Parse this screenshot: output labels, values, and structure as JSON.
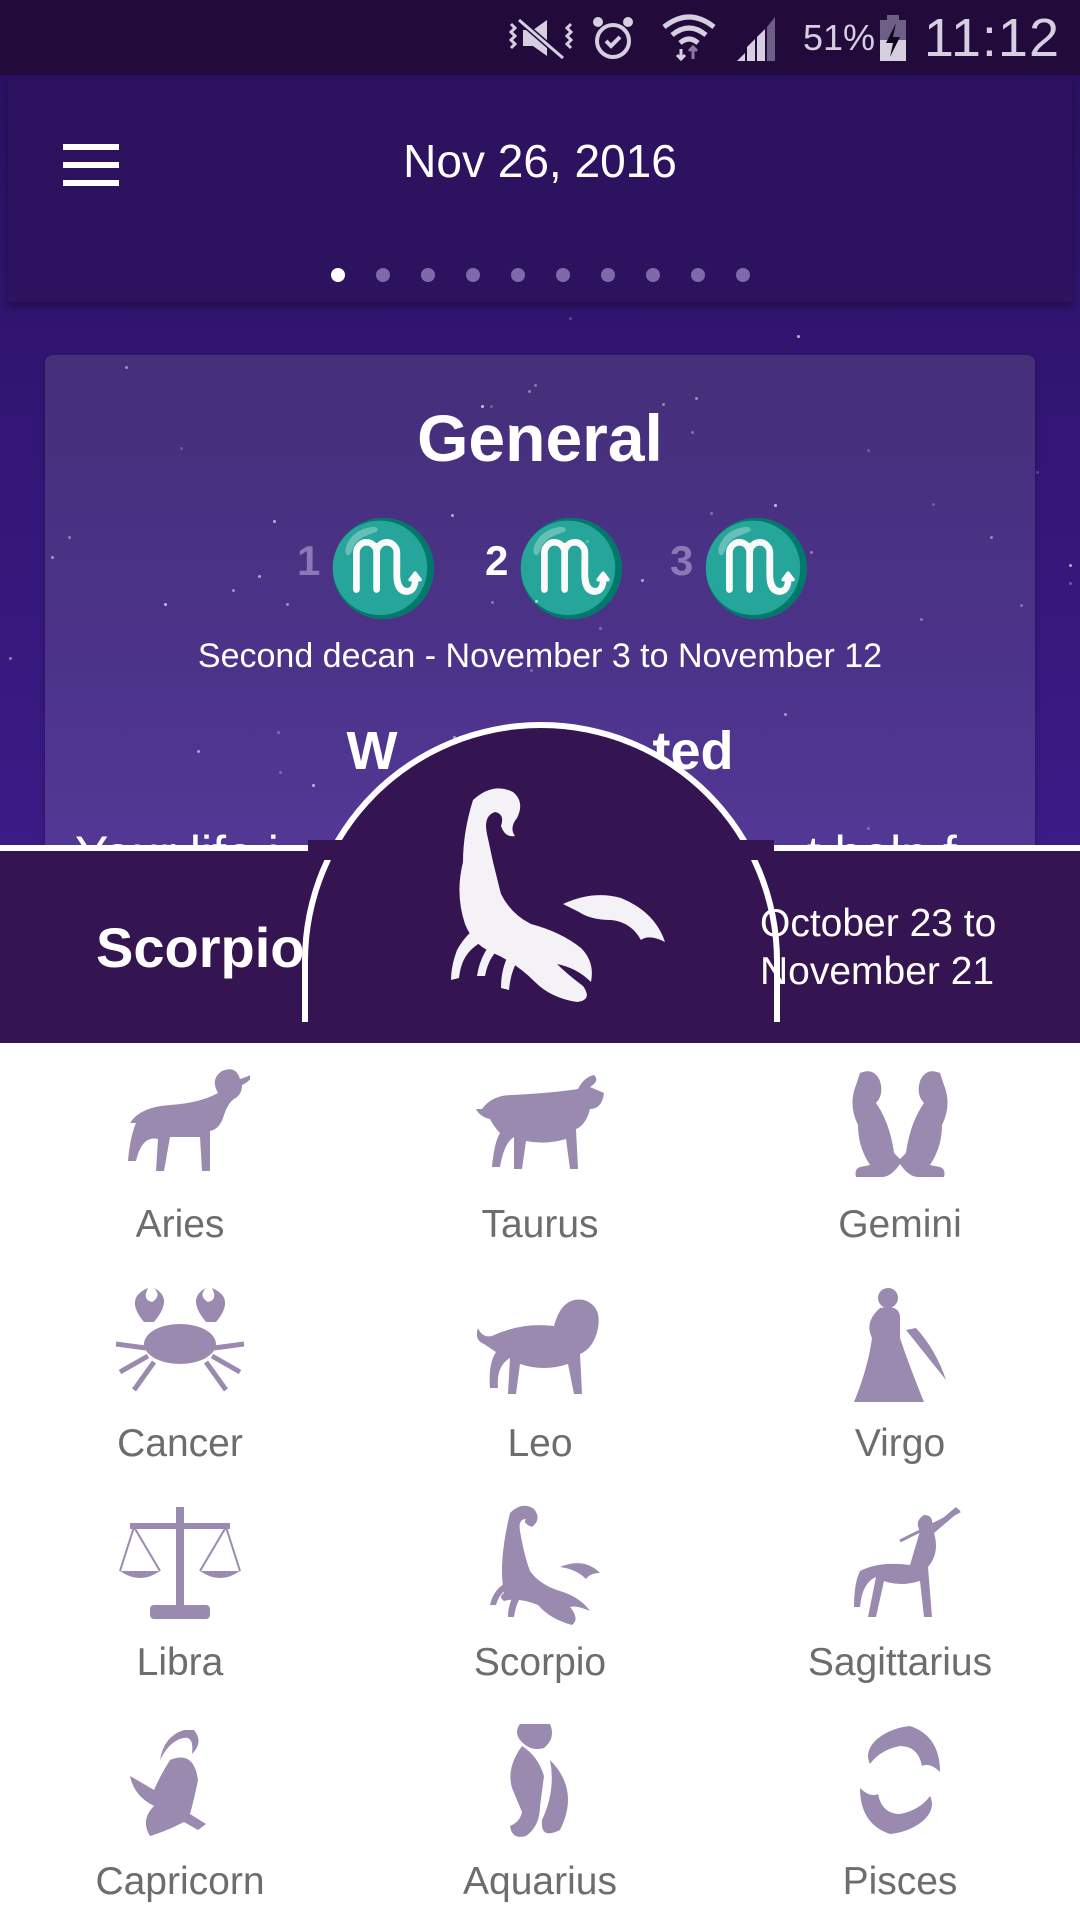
{
  "status_bar": {
    "icons": [
      "mute-vibrate-icon",
      "alarm-icon",
      "wifi-icon",
      "signal-icon",
      "battery-charging-icon"
    ],
    "battery_percent": "51%",
    "time": "11:12"
  },
  "app_bar": {
    "menu_icon": "hamburger-menu-icon",
    "title": "Nov 26, 2016",
    "page_count": 10,
    "active_page": 1
  },
  "card": {
    "title": "General",
    "decans": [
      {
        "number": "1",
        "symbol": "♏",
        "active": false
      },
      {
        "number": "2",
        "symbol": "♏",
        "active": true
      },
      {
        "number": "3",
        "symbol": "♏",
        "active": false
      }
    ],
    "decan_range": "Second decan - November 3 to November 12",
    "subtitle_visible": "W                 ted",
    "body_visible": "Your life i                                      t help f"
  },
  "current_sign": {
    "name": "Scorpio",
    "dates": "October 23 to November 21",
    "dates_line1": "October 23 to",
    "dates_line2": "November 21",
    "icon": "scorpion-icon"
  },
  "colors": {
    "status_bar": "#220b3a",
    "app_bar": "#2d1260",
    "band": "#351452",
    "sign_icon": "#9b8aaf",
    "sign_label": "#6d6d6d"
  },
  "signs": [
    {
      "name": "Aries",
      "icon": "ram-icon"
    },
    {
      "name": "Taurus",
      "icon": "bull-icon"
    },
    {
      "name": "Gemini",
      "icon": "twins-icon"
    },
    {
      "name": "Cancer",
      "icon": "crab-icon"
    },
    {
      "name": "Leo",
      "icon": "lion-icon"
    },
    {
      "name": "Virgo",
      "icon": "maiden-icon"
    },
    {
      "name": "Libra",
      "icon": "scales-icon"
    },
    {
      "name": "Scorpio",
      "icon": "scorpion-icon"
    },
    {
      "name": "Sagittarius",
      "icon": "archer-icon"
    },
    {
      "name": "Capricorn",
      "icon": "sea-goat-icon"
    },
    {
      "name": "Aquarius",
      "icon": "water-bearer-icon"
    },
    {
      "name": "Pisces",
      "icon": "fish-icon"
    }
  ]
}
